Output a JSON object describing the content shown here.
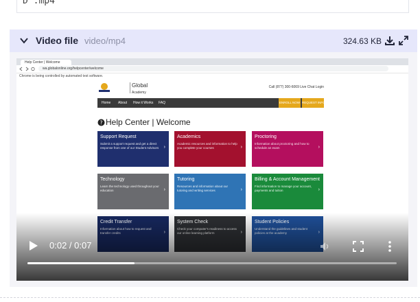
{
  "prev_file": {
    "name": "D .mp4"
  },
  "file": {
    "label": "Video file",
    "mime": "video/mp4",
    "size": "324.63 KB",
    "icons": {
      "collapse": "chevron-down-icon",
      "download": "download-icon",
      "expand": "expand-icon"
    }
  },
  "video_frame": {
    "browser_tab": "Help Center | Welcome",
    "url": "wa.globalonline.org/helpcenter/welcome",
    "notice": "Chrome is being controlled by automated test software.",
    "logo_main": "Global",
    "logo_sub": "Academy",
    "contact": "Call (877) 300-6069   Live Chat   Login",
    "nav": [
      "Home",
      "About",
      "How it Works",
      "FAQ"
    ],
    "enroll": "ENROLL NOW",
    "request_info": "REQUEST INFO",
    "help_title": "Help Center | Welcome",
    "tiles": [
      {
        "title": "Support Request",
        "desc": "Submit a support request and get a direct response from one of our Student Advisors",
        "color": "#1f2f6e"
      },
      {
        "title": "Academics",
        "desc": "Academic resources and information to help you complete your courses",
        "color": "#a3112e"
      },
      {
        "title": "Proctoring",
        "desc": "Information about proctoring and how to schedule an exam",
        "color": "#b40f5e"
      },
      {
        "title": "Technology",
        "desc": "Learn the technology used throughout your education",
        "color": "#6a6b6f"
      },
      {
        "title": "Tutoring",
        "desc": "Resources and information about our tutoring and writing services",
        "color": "#2f74b5"
      },
      {
        "title": "Billing & Account Management",
        "desc": "Find information to manage your account, payments and tuition",
        "color": "#1a8a3b"
      },
      {
        "title": "Credit Transfer",
        "desc": "Information about how to request and transfer credits",
        "color": "#17285e"
      },
      {
        "title": "System Check",
        "desc": "Check your computer's readiness to access our online learning platform",
        "color": "#2d2f33"
      },
      {
        "title": "Student Policies",
        "desc": "Understand the guidelines and student policies at the academy",
        "color": "#1f4f98"
      }
    ]
  },
  "player": {
    "current_time": "0:02",
    "duration": "0:07",
    "time_display": "0:02 / 0:07",
    "progress_fraction": 0.29,
    "icons": {
      "play": "play-icon",
      "volume": "volume-icon",
      "fullscreen": "fullscreen-icon",
      "more": "more-vertical-icon"
    }
  }
}
